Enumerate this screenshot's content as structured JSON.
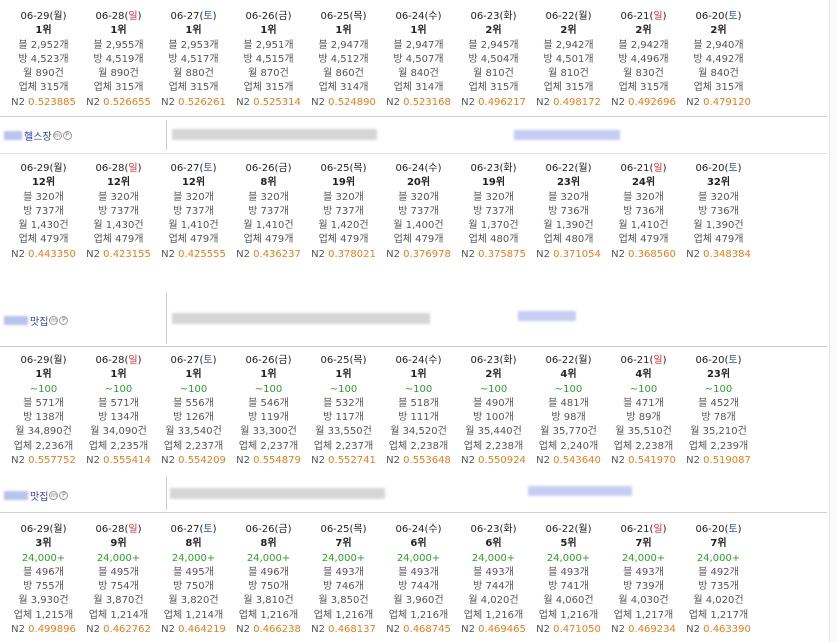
{
  "blocks": [
    {
      "keyword": "헬스장",
      "days": [
        {
          "date": "06-29",
          "dow": "월",
          "dow_type": "weekday",
          "rank": "1위",
          "blog": "블 2,952개",
          "bang": "방 4,523개",
          "month": "월 890건",
          "biz": "업체 315개",
          "n2_label": "N2",
          "n2": "0.523885"
        },
        {
          "date": "06-28",
          "dow": "일",
          "dow_type": "sun",
          "rank": "1위",
          "blog": "블 2,955개",
          "bang": "방 4,519개",
          "month": "월 890건",
          "biz": "업체 315개",
          "n2_label": "N2",
          "n2": "0.526655"
        },
        {
          "date": "06-27",
          "dow": "토",
          "dow_type": "sat",
          "rank": "1위",
          "blog": "블 2,953개",
          "bang": "방 4,517개",
          "month": "월 880건",
          "biz": "업체 315개",
          "n2_label": "N2",
          "n2": "0.526261"
        },
        {
          "date": "06-26",
          "dow": "금",
          "dow_type": "weekday",
          "rank": "1위",
          "blog": "블 2,951개",
          "bang": "방 4,515개",
          "month": "월 870건",
          "biz": "업체 315개",
          "n2_label": "N2",
          "n2": "0.525314"
        },
        {
          "date": "06-25",
          "dow": "목",
          "dow_type": "weekday",
          "rank": "1위",
          "blog": "블 2,947개",
          "bang": "방 4,512개",
          "month": "월 860건",
          "biz": "업체 314개",
          "n2_label": "N2",
          "n2": "0.524890"
        },
        {
          "date": "06-24",
          "dow": "수",
          "dow_type": "weekday",
          "rank": "1위",
          "blog": "블 2,947개",
          "bang": "방 4,507개",
          "month": "월 840건",
          "biz": "업체 314개",
          "n2_label": "N2",
          "n2": "0.523168"
        },
        {
          "date": "06-23",
          "dow": "화",
          "dow_type": "weekday",
          "rank": "2위",
          "blog": "블 2,945개",
          "bang": "방 4,504개",
          "month": "월 810건",
          "biz": "업체 315개",
          "n2_label": "N2",
          "n2": "0.496217"
        },
        {
          "date": "06-22",
          "dow": "월",
          "dow_type": "weekday",
          "rank": "2위",
          "blog": "블 2,942개",
          "bang": "방 4,501개",
          "month": "월 810건",
          "biz": "업체 315개",
          "n2_label": "N2",
          "n2": "0.498172"
        },
        {
          "date": "06-21",
          "dow": "일",
          "dow_type": "sun",
          "rank": "2위",
          "blog": "블 2,942개",
          "bang": "방 4,496개",
          "month": "월 830건",
          "biz": "업체 315개",
          "n2_label": "N2",
          "n2": "0.492696"
        },
        {
          "date": "06-20",
          "dow": "토",
          "dow_type": "sat",
          "rank": "2위",
          "blog": "블 2,940개",
          "bang": "방 4,492개",
          "month": "월 840건",
          "biz": "업체 315개",
          "n2_label": "N2",
          "n2": "0.479120"
        }
      ]
    },
    {
      "keyword": "맛집",
      "days": [
        {
          "date": "06-29",
          "dow": "월",
          "dow_type": "weekday",
          "rank": "12위",
          "blog": "블 320개",
          "bang": "방 737개",
          "month": "월 1,430건",
          "biz": "업체 479개",
          "n2_label": "N2",
          "n2": "0.443350"
        },
        {
          "date": "06-28",
          "dow": "일",
          "dow_type": "sun",
          "rank": "12위",
          "blog": "블 320개",
          "bang": "방 737개",
          "month": "월 1,430건",
          "biz": "업체 479개",
          "n2_label": "N2",
          "n2": "0.423155"
        },
        {
          "date": "06-27",
          "dow": "토",
          "dow_type": "sat",
          "rank": "12위",
          "blog": "블 320개",
          "bang": "방 737개",
          "month": "월 1,410건",
          "biz": "업체 479개",
          "n2_label": "N2",
          "n2": "0.425555"
        },
        {
          "date": "06-26",
          "dow": "금",
          "dow_type": "weekday",
          "rank": "8위",
          "blog": "블 320개",
          "bang": "방 737개",
          "month": "월 1,410건",
          "biz": "업체 479개",
          "n2_label": "N2",
          "n2": "0.436237"
        },
        {
          "date": "06-25",
          "dow": "목",
          "dow_type": "weekday",
          "rank": "19위",
          "blog": "블 320개",
          "bang": "방 737개",
          "month": "월 1,420건",
          "biz": "업체 479개",
          "n2_label": "N2",
          "n2": "0.378021"
        },
        {
          "date": "06-24",
          "dow": "수",
          "dow_type": "weekday",
          "rank": "20위",
          "blog": "블 320개",
          "bang": "방 737개",
          "month": "월 1,400건",
          "biz": "업체 479개",
          "n2_label": "N2",
          "n2": "0.376978"
        },
        {
          "date": "06-23",
          "dow": "화",
          "dow_type": "weekday",
          "rank": "19위",
          "blog": "블 320개",
          "bang": "방 737개",
          "month": "월 1,370건",
          "biz": "업체 480개",
          "n2_label": "N2",
          "n2": "0.375875"
        },
        {
          "date": "06-22",
          "dow": "월",
          "dow_type": "weekday",
          "rank": "23위",
          "blog": "블 320개",
          "bang": "방 736개",
          "month": "월 1,390건",
          "biz": "업체 480개",
          "n2_label": "N2",
          "n2": "0.371054"
        },
        {
          "date": "06-21",
          "dow": "일",
          "dow_type": "sun",
          "rank": "24위",
          "blog": "블 320개",
          "bang": "방 736개",
          "month": "월 1,410건",
          "biz": "업체 479개",
          "n2_label": "N2",
          "n2": "0.368560"
        },
        {
          "date": "06-20",
          "dow": "토",
          "dow_type": "sat",
          "rank": "32위",
          "blog": "블 320개",
          "bang": "방 736개",
          "month": "월 1,390건",
          "biz": "업체 479개",
          "n2_label": "N2",
          "n2": "0.348384"
        }
      ]
    },
    {
      "keyword": "맛집",
      "days": [
        {
          "date": "06-29",
          "dow": "월",
          "dow_type": "weekday",
          "rank": "1위",
          "delta": "~100",
          "blog": "블 571개",
          "bang": "방 138개",
          "month": "월 34,890건",
          "biz": "업체 2,236개",
          "n2_label": "N2",
          "n2": "0.557752"
        },
        {
          "date": "06-28",
          "dow": "일",
          "dow_type": "sun",
          "rank": "1위",
          "delta": "~100",
          "blog": "블 571개",
          "bang": "방 134개",
          "month": "월 34,090건",
          "biz": "업체 2,235개",
          "n2_label": "N2",
          "n2": "0.555414"
        },
        {
          "date": "06-27",
          "dow": "토",
          "dow_type": "sat",
          "rank": "1위",
          "delta": "~100",
          "blog": "블 556개",
          "bang": "방 126개",
          "month": "월 33,540건",
          "biz": "업체 2,237개",
          "n2_label": "N2",
          "n2": "0.554209"
        },
        {
          "date": "06-26",
          "dow": "금",
          "dow_type": "weekday",
          "rank": "1위",
          "delta": "~100",
          "blog": "블 546개",
          "bang": "방 119개",
          "month": "월 33,300건",
          "biz": "업체 2,237개",
          "n2_label": "N2",
          "n2": "0.554879"
        },
        {
          "date": "06-25",
          "dow": "목",
          "dow_type": "weekday",
          "rank": "1위",
          "delta": "~100",
          "blog": "블 532개",
          "bang": "방 117개",
          "month": "월 33,550건",
          "biz": "업체 2,237개",
          "n2_label": "N2",
          "n2": "0.552741"
        },
        {
          "date": "06-24",
          "dow": "수",
          "dow_type": "weekday",
          "rank": "1위",
          "delta": "~100",
          "blog": "블 518개",
          "bang": "방 111개",
          "month": "월 34,520건",
          "biz": "업체 2,238개",
          "n2_label": "N2",
          "n2": "0.553648"
        },
        {
          "date": "06-23",
          "dow": "화",
          "dow_type": "weekday",
          "rank": "2위",
          "delta": "~100",
          "blog": "블 490개",
          "bang": "방 100개",
          "month": "월 35,440건",
          "biz": "업체 2,238개",
          "n2_label": "N2",
          "n2": "0.550924"
        },
        {
          "date": "06-22",
          "dow": "월",
          "dow_type": "weekday",
          "rank": "4위",
          "delta": "~100",
          "blog": "블 481개",
          "bang": "방 98개",
          "month": "월 35,770건",
          "biz": "업체 2,240개",
          "n2_label": "N2",
          "n2": "0.543640"
        },
        {
          "date": "06-21",
          "dow": "일",
          "dow_type": "sun",
          "rank": "4위",
          "delta": "~100",
          "blog": "블 471개",
          "bang": "방 89개",
          "month": "월 35,510건",
          "biz": "업체 2,238개",
          "n2_label": "N2",
          "n2": "0.541970"
        },
        {
          "date": "06-20",
          "dow": "토",
          "dow_type": "sat",
          "rank": "23위",
          "delta": "~100",
          "blog": "블 452개",
          "bang": "방 78개",
          "month": "월 35,210건",
          "biz": "업체 2,239개",
          "n2_label": "N2",
          "n2": "0.519087"
        }
      ]
    },
    {
      "keyword": "",
      "days": [
        {
          "date": "06-29",
          "dow": "월",
          "dow_type": "weekday",
          "rank": "3위",
          "delta": "24,000+",
          "blog": "블 496개",
          "bang": "방 755개",
          "month": "월 3,930건",
          "biz": "업체 1,215개",
          "n2_label": "N2",
          "n2": "0.499896"
        },
        {
          "date": "06-28",
          "dow": "일",
          "dow_type": "sun",
          "rank": "9위",
          "delta": "24,000+",
          "blog": "블 495개",
          "bang": "방 754개",
          "month": "월 3,870건",
          "biz": "업체 1,214개",
          "n2_label": "N2",
          "n2": "0.462762"
        },
        {
          "date": "06-27",
          "dow": "토",
          "dow_type": "sat",
          "rank": "8위",
          "delta": "24,000+",
          "blog": "블 495개",
          "bang": "방 750개",
          "month": "월 3,820건",
          "biz": "업체 1,214개",
          "n2_label": "N2",
          "n2": "0.464219"
        },
        {
          "date": "06-26",
          "dow": "금",
          "dow_type": "weekday",
          "rank": "8위",
          "delta": "24,000+",
          "blog": "블 496개",
          "bang": "방 750개",
          "month": "월 3,810건",
          "biz": "업체 1,216개",
          "n2_label": "N2",
          "n2": "0.466238"
        },
        {
          "date": "06-25",
          "dow": "목",
          "dow_type": "weekday",
          "rank": "7위",
          "delta": "24,000+",
          "blog": "블 493개",
          "bang": "방 746개",
          "month": "월 3,850건",
          "biz": "업체 1,216개",
          "n2_label": "N2",
          "n2": "0.468137"
        },
        {
          "date": "06-24",
          "dow": "수",
          "dow_type": "weekday",
          "rank": "6위",
          "delta": "24,000+",
          "blog": "블 493개",
          "bang": "방 744개",
          "month": "월 3,960건",
          "biz": "업체 1,216개",
          "n2_label": "N2",
          "n2": "0.468745"
        },
        {
          "date": "06-23",
          "dow": "화",
          "dow_type": "weekday",
          "rank": "6위",
          "delta": "24,000+",
          "blog": "블 493개",
          "bang": "방 744개",
          "month": "월 4,020건",
          "biz": "업체 1,216개",
          "n2_label": "N2",
          "n2": "0.469465"
        },
        {
          "date": "06-22",
          "dow": "월",
          "dow_type": "weekday",
          "rank": "5위",
          "delta": "24,000+",
          "blog": "블 493개",
          "bang": "방 741개",
          "month": "월 4,060건",
          "biz": "업체 1,216개",
          "n2_label": "N2",
          "n2": "0.471050"
        },
        {
          "date": "06-21",
          "dow": "일",
          "dow_type": "sun",
          "rank": "7위",
          "delta": "24,000+",
          "blog": "블 493개",
          "bang": "방 739개",
          "month": "월 4,030건",
          "biz": "업체 1,217개",
          "n2_label": "N2",
          "n2": "0.469234"
        },
        {
          "date": "06-20",
          "dow": "토",
          "dow_type": "sat",
          "rank": "7위",
          "delta": "24,000+",
          "blog": "블 492개",
          "bang": "방 735개",
          "month": "월 4,020건",
          "biz": "업체 1,217개",
          "n2_label": "N2",
          "n2": "0.463390"
        }
      ]
    }
  ]
}
